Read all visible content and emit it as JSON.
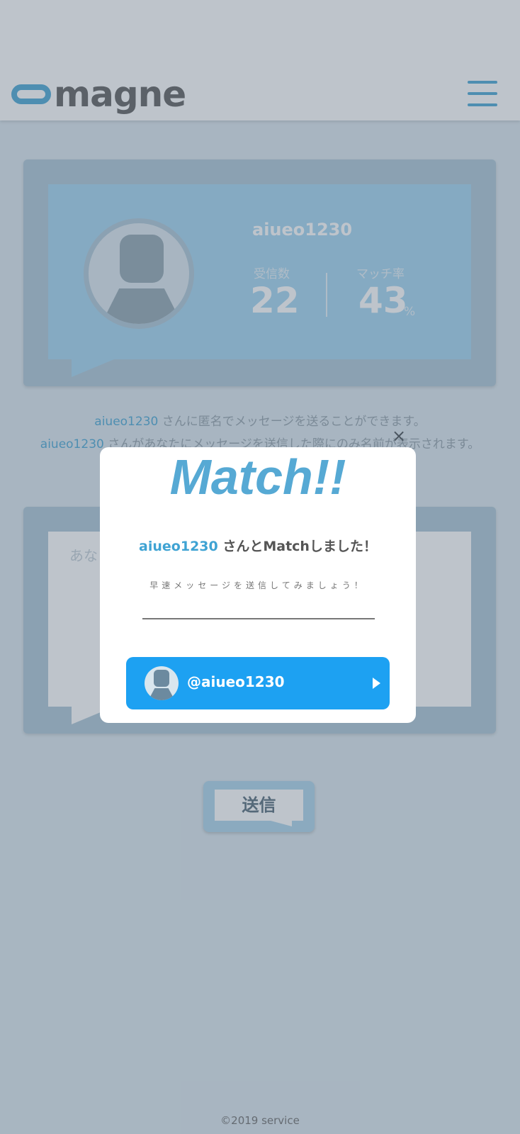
{
  "header": {
    "logo_text": "magne"
  },
  "profile": {
    "username": "aiueo1230",
    "received_label": "受信数",
    "received_value": "22",
    "match_rate_label": "マッチ率",
    "match_rate_value": "43",
    "match_rate_unit": "%"
  },
  "info": {
    "line1_name": "aiueo1230",
    "line1_text": " さんに匿名でメッセージを送ることができます。",
    "line2_name": "aiueo1230",
    "line2_text": " さんがあなたにメッセージを送信した際にのみ名前が表示されます。"
  },
  "message": {
    "placeholder": "あな"
  },
  "send_button": {
    "label": "送信"
  },
  "footer": {
    "copyright": "©2019 service"
  },
  "modal": {
    "close_label": "×",
    "title": "Match!!",
    "match_name": "aiueo1230",
    "match_text": " さんとMatchしました！",
    "subtitle": "早速メッセージを送信してみましょう！",
    "button_handle": "@aiueo1230"
  },
  "colors": {
    "accent": "#3fa3d3",
    "twitter_blue": "#1da1f2",
    "modal_title": "#56a9d4"
  }
}
